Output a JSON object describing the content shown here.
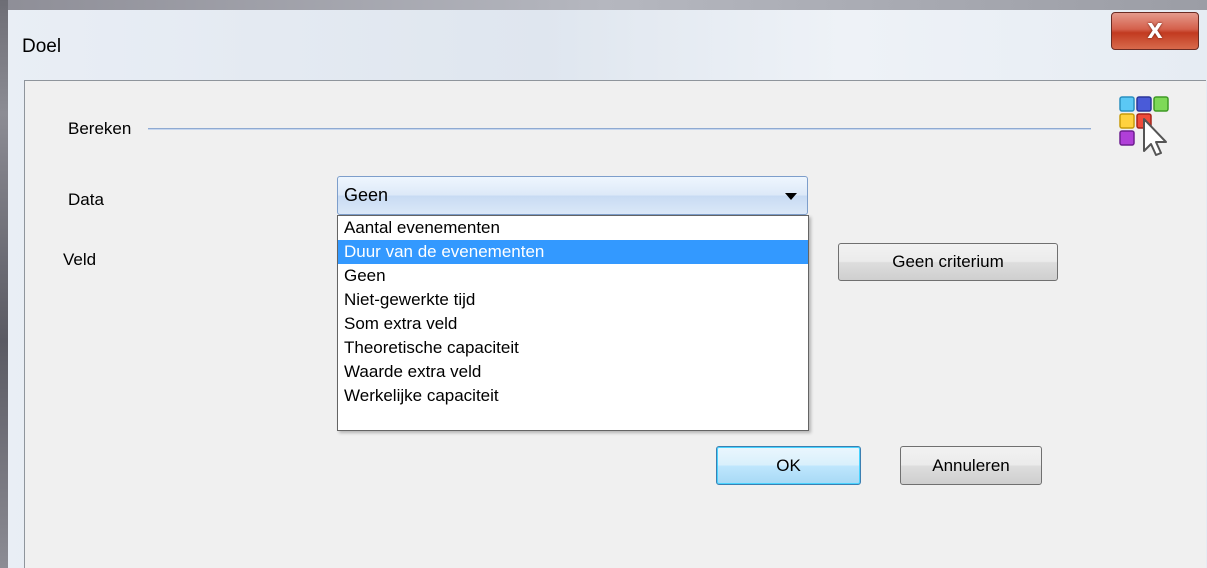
{
  "window": {
    "title": "Doel",
    "close_label": "X"
  },
  "group": {
    "label": "Bereken"
  },
  "fields": {
    "data_label": "Data",
    "veld_label": "Veld"
  },
  "data_combo": {
    "selected": "Geen",
    "options": [
      {
        "label": "Aantal evenementen",
        "highlighted": false
      },
      {
        "label": "Duur van de evenementen",
        "highlighted": true
      },
      {
        "label": "Geen",
        "highlighted": false
      },
      {
        "label": "Niet-gewerkte tijd",
        "highlighted": false
      },
      {
        "label": "Som extra veld",
        "highlighted": false
      },
      {
        "label": "Theoretische capaciteit",
        "highlighted": false
      },
      {
        "label": "Waarde extra veld",
        "highlighted": false
      },
      {
        "label": "Werkelijke capaciteit",
        "highlighted": false
      }
    ]
  },
  "buttons": {
    "criterium": "Geen criterium",
    "ok": "OK",
    "cancel": "Annuleren"
  },
  "colors": {
    "highlight": "#3399ff",
    "close_button": "#c23a20",
    "group_line": "#8faad2"
  },
  "icons": {
    "app": "colored-grid-cursor-icon",
    "dropdown_arrow": "chevron-down-icon"
  }
}
